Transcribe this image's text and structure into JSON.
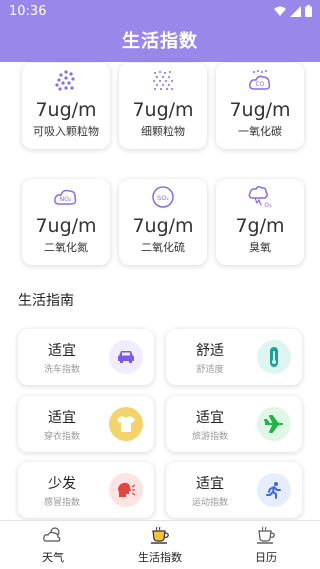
{
  "status_bar": {
    "time": "10:36"
  },
  "app_bar": {
    "title": "生活指数"
  },
  "air_quality": [
    {
      "value": "7ug/m",
      "name": "可吸入颗粒物",
      "icon": "pm10-dots-icon"
    },
    {
      "value": "7ug/m",
      "name": "细颗粒物",
      "icon": "pm25-dots-icon"
    },
    {
      "value": "7ug/m",
      "name": "一氧化碳",
      "icon": "co-cloud-icon",
      "icon_text": "CO"
    },
    {
      "value": "7ug/m",
      "name": "二氧化氮",
      "icon": "no2-cloud-icon",
      "icon_text": "NO₂"
    },
    {
      "value": "7ug/m",
      "name": "二氧化硫",
      "icon": "so2-circle-icon",
      "icon_text": "SO₂"
    },
    {
      "value": "7g/m",
      "name": "臭氧",
      "icon": "o3-icon",
      "icon_text": "O₃"
    }
  ],
  "guide_section": {
    "title": "生活指南"
  },
  "guide": [
    {
      "status": "适宜",
      "label": "洗车指数",
      "icon": "car-icon",
      "color": "#f1ecff",
      "icon_color": "#7b5ce0"
    },
    {
      "status": "舒适",
      "label": "舒适度",
      "icon": "thermometer-icon",
      "color": "#def5f1",
      "icon_color": "#1aa390"
    },
    {
      "status": "适宜",
      "label": "穿衣指数",
      "icon": "shirt-icon",
      "color": "#f3d36b",
      "icon_color": "#ffffff"
    },
    {
      "status": "适宜",
      "label": "旅游指数",
      "icon": "airplane-icon",
      "color": "#e2f6e6",
      "icon_color": "#21b34a"
    },
    {
      "status": "少发",
      "label": "感冒指数",
      "icon": "sneeze-icon",
      "color": "#fde4e4",
      "icon_color": "#e0463e"
    },
    {
      "status": "适宜",
      "label": "运动指数",
      "icon": "running-icon",
      "color": "#e5edff",
      "icon_color": "#3c6ae8"
    }
  ],
  "nav": [
    {
      "label": "天气",
      "icon": "weather-icon"
    },
    {
      "label": "生活指数",
      "icon": "coffee-cup-icon"
    },
    {
      "label": "日历",
      "icon": "calendar-cup-icon"
    }
  ],
  "colors": {
    "accent": "#9a87ea",
    "purple_icon": "#8a6be8"
  }
}
